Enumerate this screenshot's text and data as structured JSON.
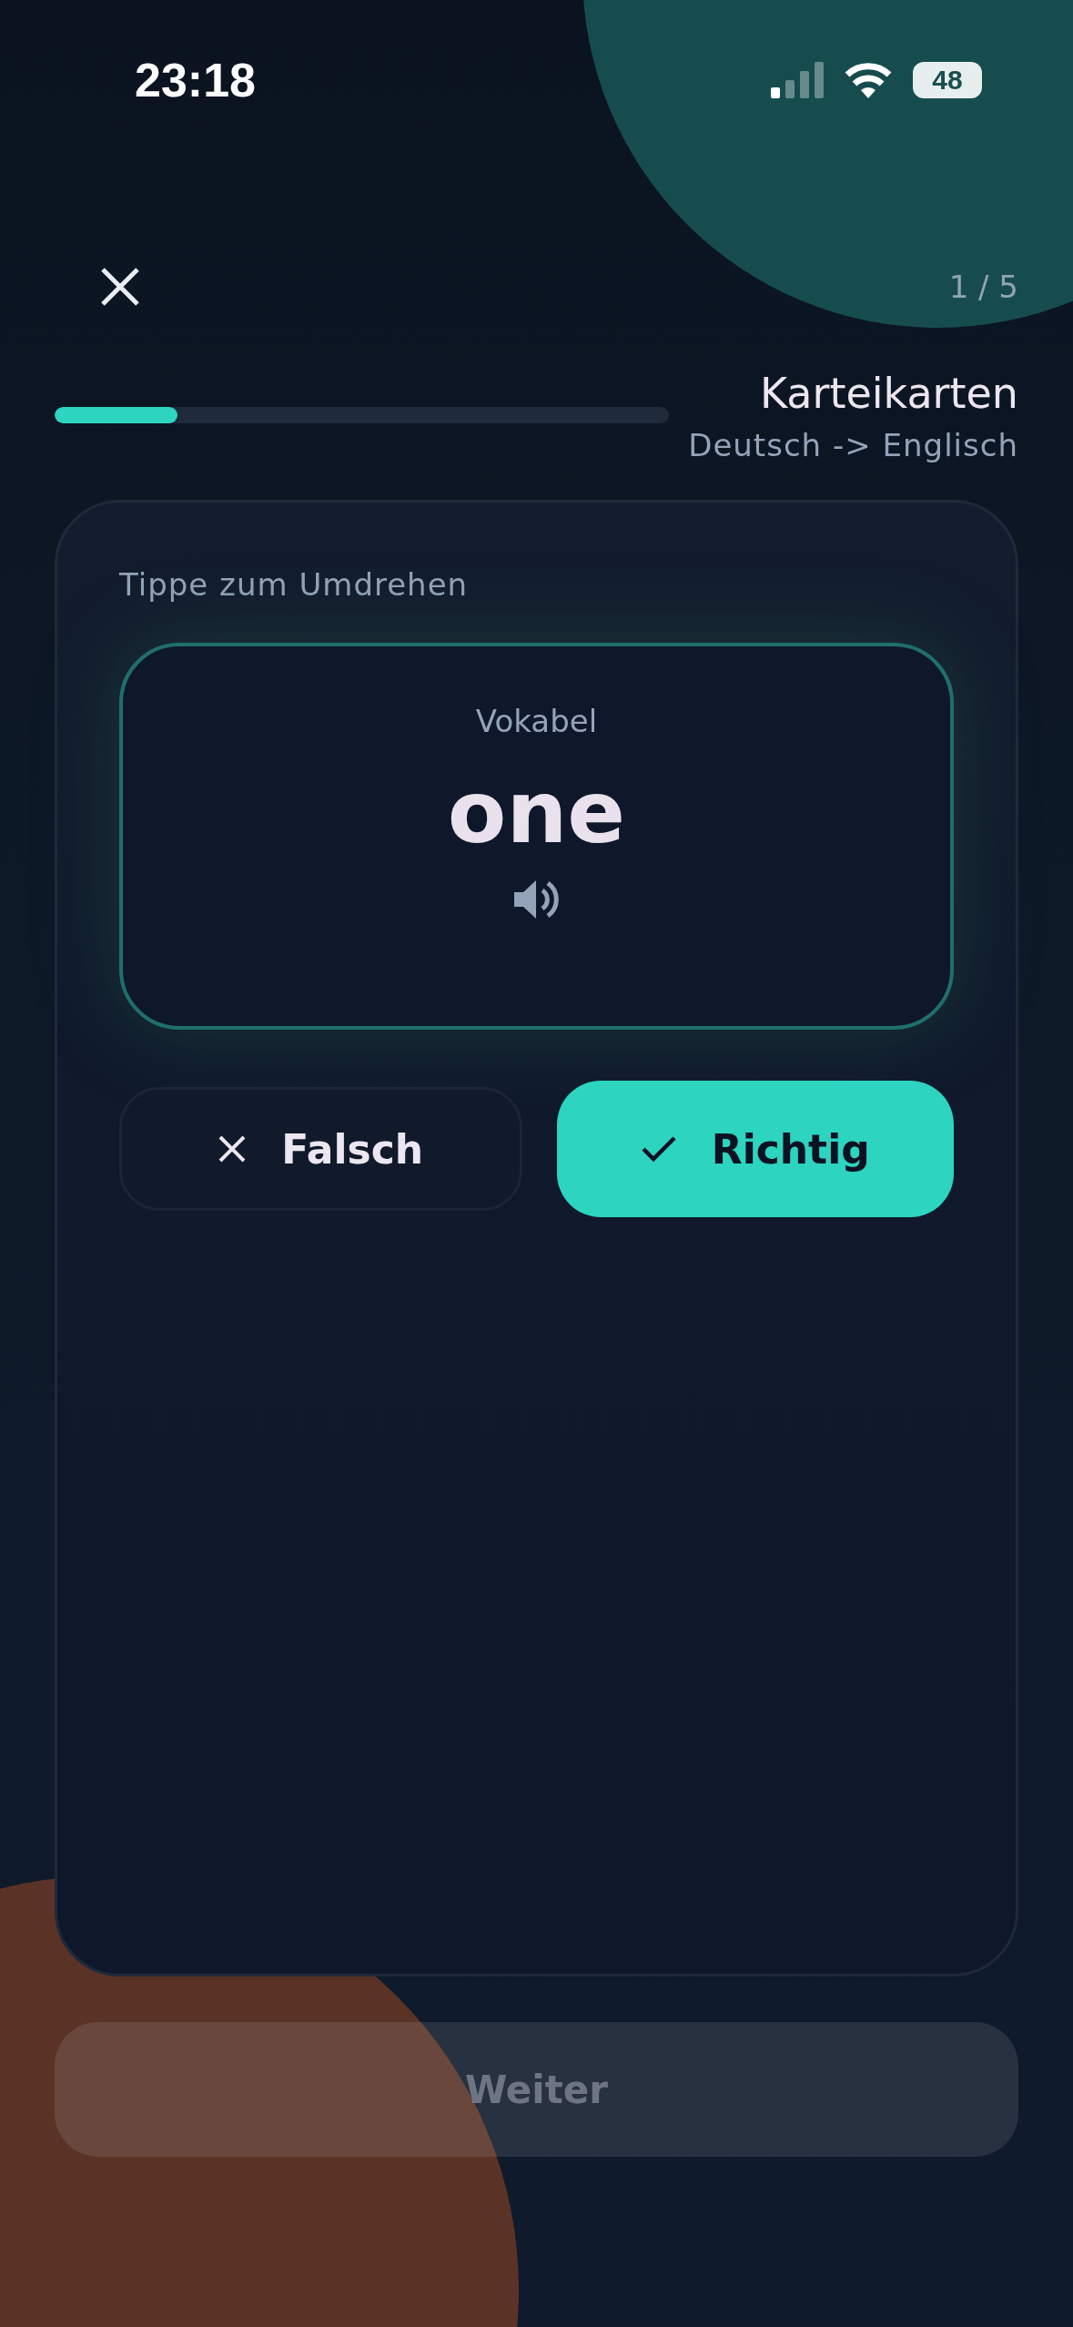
{
  "status_bar": {
    "time": "23:18",
    "battery": "48"
  },
  "header": {
    "counter": "1 / 5",
    "progress": {
      "level": 0.2
    },
    "title": "Karteikarten",
    "subtitle": "Deutsch -> Englisch"
  },
  "card": {
    "hint": "Tippe zum Umdrehen",
    "flashcard": {
      "label": "Vokabel",
      "word": "one"
    },
    "answers": [
      {
        "kind": "wrong",
        "label": "Falsch",
        "selected": false
      },
      {
        "kind": "right",
        "label": "Richtig",
        "selected": true
      }
    ]
  },
  "next_button": {
    "label": "Weiter",
    "disabled": true
  }
}
